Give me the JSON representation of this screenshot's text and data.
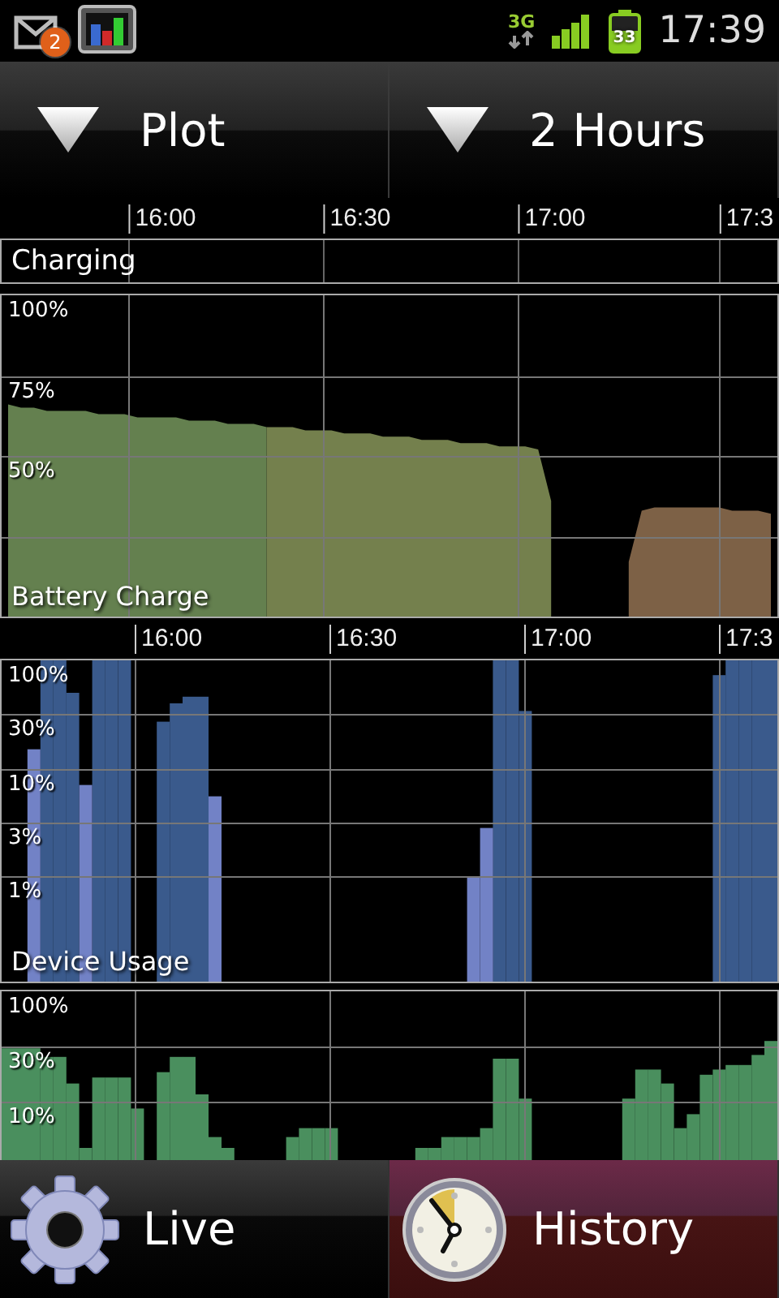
{
  "status_bar": {
    "notification_count": "2",
    "network": "3G",
    "battery": "33",
    "time": "17:39"
  },
  "spinners": [
    {
      "label": "Plot"
    },
    {
      "label": "2 Hours"
    }
  ],
  "charging": {
    "label": "Charging"
  },
  "battery_chart": {
    "chart_data": {
      "type": "area",
      "title": "Battery Charge",
      "grid": true,
      "ylim": [
        0,
        100
      ],
      "yticks": [
        {
          "value": 100,
          "label": "100%"
        },
        {
          "value": 75,
          "label": "75%"
        },
        {
          "value": 50,
          "label": "50%"
        }
      ],
      "categories": [
        null,
        null,
        null,
        null,
        null,
        null,
        null,
        null,
        null,
        null,
        null,
        null,
        "16:00",
        null,
        null,
        null,
        null,
        null,
        null,
        null,
        null,
        null,
        null,
        null,
        null,
        null,
        null,
        "16:30",
        null,
        null,
        null,
        null,
        null,
        null,
        null,
        null,
        null,
        null,
        null,
        null,
        null,
        null,
        "17:00",
        null,
        null,
        null,
        null,
        null,
        null,
        null,
        null,
        null,
        null,
        null,
        null,
        null,
        null,
        "17:3",
        null,
        null
      ],
      "series": [
        {
          "color": "#64804f",
          "values": [
            66,
            65,
            65,
            64,
            64,
            64,
            64,
            63,
            63,
            63,
            62,
            62,
            62,
            62,
            61,
            61,
            61,
            60,
            60,
            60,
            59,
            null,
            null,
            null,
            null,
            null,
            null,
            null,
            null,
            null,
            null,
            null,
            null,
            null,
            null,
            null,
            null,
            null,
            null,
            null,
            null,
            null,
            null,
            null,
            null,
            null,
            null,
            null,
            null,
            null,
            null,
            null,
            null,
            null,
            null,
            null,
            null,
            null,
            null,
            null
          ]
        },
        {
          "color": "#74804d",
          "values": [
            null,
            null,
            null,
            null,
            null,
            null,
            null,
            null,
            null,
            null,
            null,
            null,
            null,
            null,
            null,
            null,
            null,
            null,
            null,
            null,
            59,
            59,
            59,
            58,
            58,
            58,
            57,
            57,
            57,
            56,
            56,
            56,
            55,
            55,
            55,
            54,
            54,
            54,
            53,
            53,
            53,
            52,
            36,
            null,
            null,
            null,
            null,
            null,
            null,
            null,
            null,
            null,
            null,
            null,
            null,
            null,
            null,
            null,
            null,
            null
          ]
        },
        {
          "color": "#7d6146",
          "values": [
            null,
            null,
            null,
            null,
            null,
            null,
            null,
            null,
            null,
            null,
            null,
            null,
            null,
            null,
            null,
            null,
            null,
            null,
            null,
            null,
            null,
            null,
            null,
            null,
            null,
            null,
            null,
            null,
            null,
            null,
            null,
            null,
            null,
            null,
            null,
            null,
            null,
            null,
            null,
            null,
            null,
            null,
            null,
            null,
            null,
            null,
            null,
            null,
            17,
            33,
            34,
            34,
            34,
            34,
            34,
            34,
            33,
            33,
            33,
            32
          ]
        }
      ]
    }
  },
  "usage_charts": [
    {
      "time_labels": [
        "16:00",
        "16:30",
        "17:00",
        "17:3"
      ],
      "axis_labels": [
        "100%",
        "30%",
        "10%",
        "3%",
        "1%"
      ],
      "title": "Device Usage"
    },
    {
      "axis_labels": [
        "100%",
        "30%",
        "10%"
      ]
    }
  ],
  "tabs": [
    {
      "label": "Live",
      "selected": false
    },
    {
      "label": "History",
      "selected": true
    }
  ]
}
